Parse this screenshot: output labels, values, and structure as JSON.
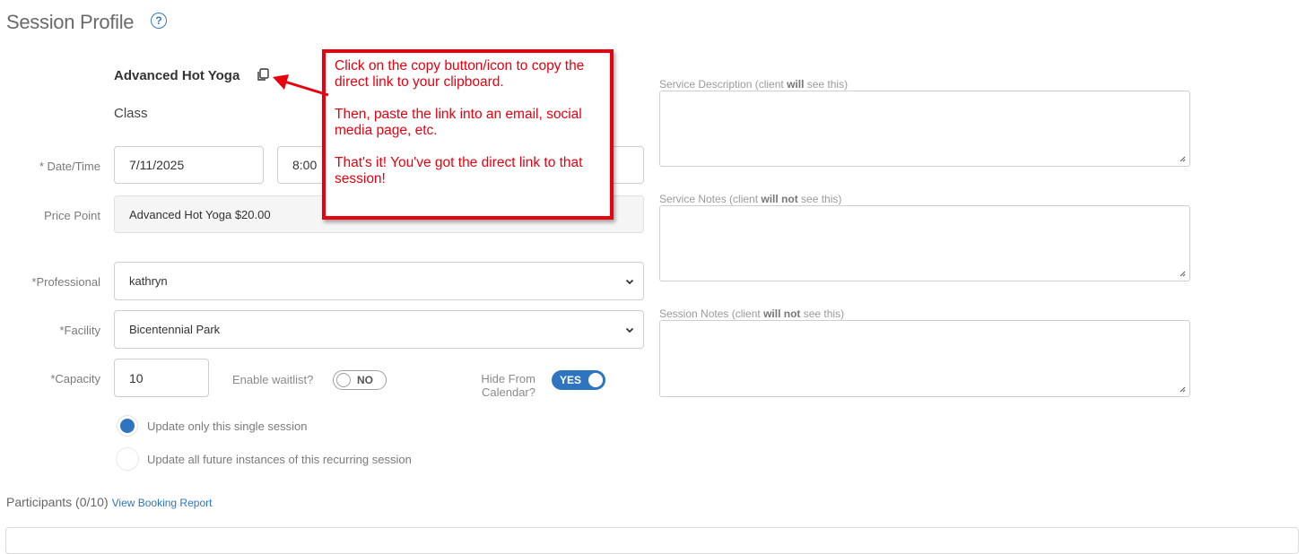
{
  "header": {
    "title": "Session Profile",
    "help_icon": "question-circle-icon"
  },
  "session": {
    "name": "Advanced Hot Yoga",
    "type": "Class"
  },
  "form": {
    "datetime": {
      "label": "* Date/Time",
      "date": "7/11/2025",
      "time": "8:00"
    },
    "price_point": {
      "label": "Price Point",
      "value": "Advanced Hot Yoga $20.00"
    },
    "professional": {
      "label": "*Professional",
      "value": "kathryn"
    },
    "facility": {
      "label": "*Facility",
      "value": "Bicentennial Park"
    },
    "capacity": {
      "label": "*Capacity",
      "value": "10"
    },
    "waitlist": {
      "label": "Enable waitlist?",
      "state": "NO"
    },
    "hide_calendar": {
      "label_line1": "Hide From",
      "label_line2": "Calendar?",
      "state": "YES"
    },
    "update_options": [
      {
        "label": "Update only this single session",
        "checked": true
      },
      {
        "label": "Update all future instances of this recurring session",
        "checked": false
      }
    ]
  },
  "notes": {
    "service_description": {
      "prefix": "Service Description (client ",
      "bold": "will",
      "suffix": " see this)"
    },
    "service_notes": {
      "prefix": "Service Notes (client ",
      "bold": "will not",
      "suffix": " see this)"
    },
    "session_notes": {
      "prefix": "Session Notes (client ",
      "bold": "will not",
      "suffix": " see this)"
    }
  },
  "participants": {
    "label": "Participants (0/10)",
    "link": "View Booking Report"
  },
  "callout": {
    "line1": "Click on the copy button/icon to copy the direct link to your clipboard.",
    "line2": "Then, paste the link into an email, social media page, etc.",
    "line3": "That's it! You've got the direct link to that session!"
  },
  "colors": {
    "accent": "#2f74c1",
    "callout_red": "#e8000f"
  }
}
